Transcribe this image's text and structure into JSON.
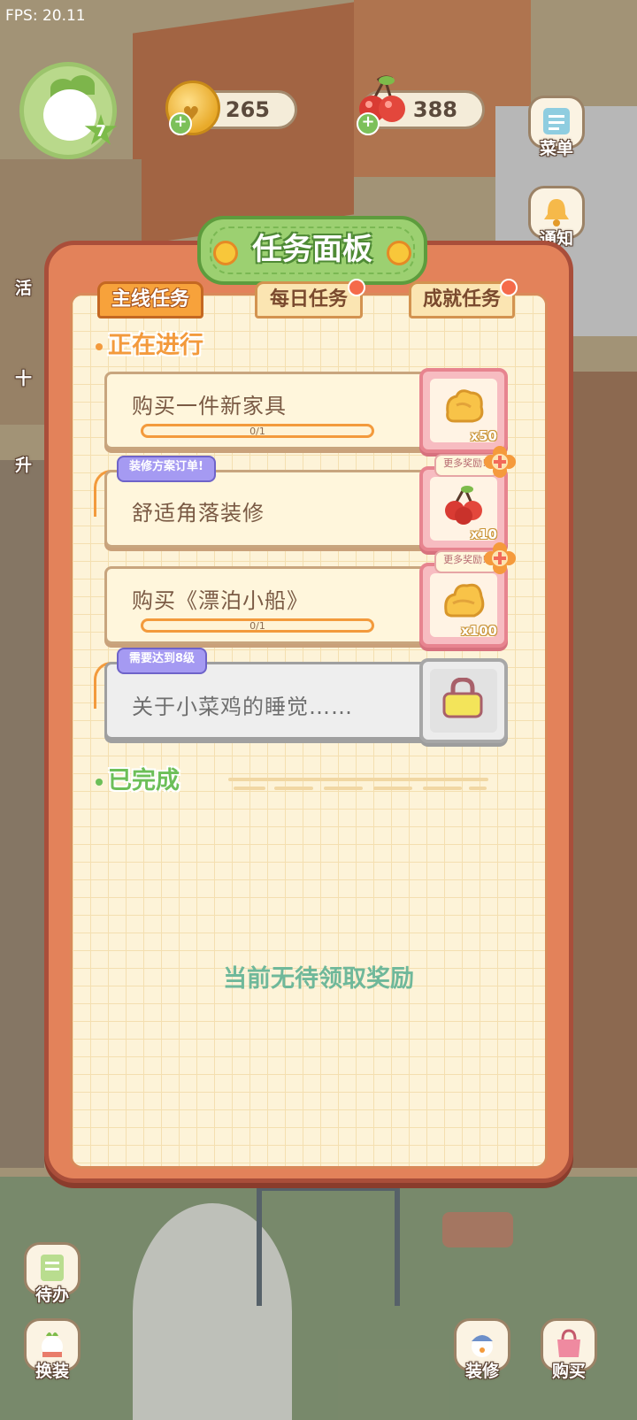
{
  "hud": {
    "fps": "FPS: 20.11",
    "player_level": "7",
    "coins": "265",
    "cherries": "388"
  },
  "side_buttons": {
    "menu": "菜单",
    "notify": "通知",
    "todo": "待办",
    "outfit": "换装",
    "renovate": "装修",
    "buy": "购买"
  },
  "left_edge_glyphs": [
    "活",
    "十",
    "升"
  ],
  "panel": {
    "title": "任务面板",
    "tabs": [
      {
        "label": "主线任务",
        "active": true
      },
      {
        "label": "每日任务",
        "active": false
      },
      {
        "label": "成就任务",
        "active": false
      }
    ],
    "in_progress_label": "正在进行",
    "completed_label": "已完成",
    "empty_message": "当前无待领取奖励",
    "tasks": [
      {
        "name": "购买一件新家具",
        "progress": "0/1",
        "reward_qty": "x50",
        "reward_icon": "gold-nugget-icon"
      },
      {
        "tag": "装修方案订单!",
        "name": "舒适角落装修",
        "bonus_label": "更多奖励!!",
        "reward_qty": "x10",
        "reward_icon": "cherry-icon"
      },
      {
        "name": "购买《漂泊小船》",
        "progress": "0/1",
        "bonus_label": "更多奖励!!",
        "reward_qty": "x100",
        "reward_icon": "gold-nugget-icon"
      },
      {
        "tag": "需要达到8级",
        "name": "关于小菜鸡的睡觉……",
        "reward_icon": "lock-icon"
      }
    ]
  },
  "colors": {
    "panel_frame": "#e3825a",
    "accent_orange": "#f39a3c",
    "title_green": "#9cd071",
    "reward_pink": "#f7bcc1",
    "tag_purple": "#a59af2"
  }
}
